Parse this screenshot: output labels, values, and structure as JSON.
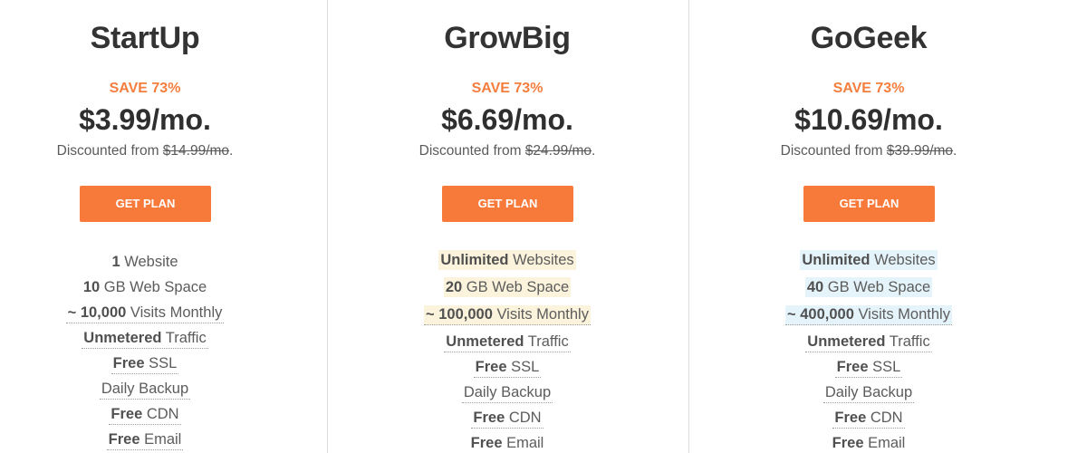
{
  "accent_color": "#f87a3b",
  "save_color": "#f47e3e",
  "plans": [
    {
      "name": "StartUp",
      "save_label": "SAVE 73%",
      "price": "$3.99/mo.",
      "discount_prefix": "Discounted from ",
      "original_price": "$14.99/mo",
      "discount_suffix": ".",
      "cta_label": "GET PLAN",
      "features": [
        {
          "bold": "1",
          "text": " Website"
        },
        {
          "bold": "10",
          "text": " GB Web Space"
        },
        {
          "bold": "~ 10,000",
          "text": " Visits Monthly"
        },
        {
          "bold": "Unmetered",
          "text": " Traffic"
        },
        {
          "bold": "Free",
          "text": " SSL"
        },
        {
          "bold": "",
          "text": "Daily Backup"
        },
        {
          "bold": "Free",
          "text": " CDN"
        },
        {
          "bold": "Free",
          "text": " Email"
        }
      ]
    },
    {
      "name": "GrowBig",
      "save_label": "SAVE 73%",
      "price": "$6.69/mo.",
      "discount_prefix": "Discounted from ",
      "original_price": "$24.99/mo",
      "discount_suffix": ".",
      "cta_label": "GET PLAN",
      "highlight_color": "#fbf3dc",
      "features": [
        {
          "bold": "Unlimited",
          "text": " Websites"
        },
        {
          "bold": "20",
          "text": " GB Web Space"
        },
        {
          "bold": "~ 100,000",
          "text": " Visits Monthly"
        },
        {
          "bold": "Unmetered",
          "text": " Traffic"
        },
        {
          "bold": "Free",
          "text": " SSL"
        },
        {
          "bold": "",
          "text": "Daily Backup"
        },
        {
          "bold": "Free",
          "text": " CDN"
        },
        {
          "bold": "Free",
          "text": " Email"
        }
      ]
    },
    {
      "name": "GoGeek",
      "save_label": "SAVE 73%",
      "price": "$10.69/mo.",
      "discount_prefix": "Discounted from ",
      "original_price": "$39.99/mo",
      "discount_suffix": ".",
      "cta_label": "GET PLAN",
      "highlight_color": "#e5f4fb",
      "features": [
        {
          "bold": "Unlimited",
          "text": " Websites"
        },
        {
          "bold": "40",
          "text": " GB Web Space"
        },
        {
          "bold": "~ 400,000",
          "text": " Visits Monthly"
        },
        {
          "bold": "Unmetered",
          "text": " Traffic"
        },
        {
          "bold": "Free",
          "text": " SSL"
        },
        {
          "bold": "",
          "text": "Daily Backup"
        },
        {
          "bold": "Free",
          "text": " CDN"
        },
        {
          "bold": "Free",
          "text": " Email"
        }
      ]
    }
  ]
}
